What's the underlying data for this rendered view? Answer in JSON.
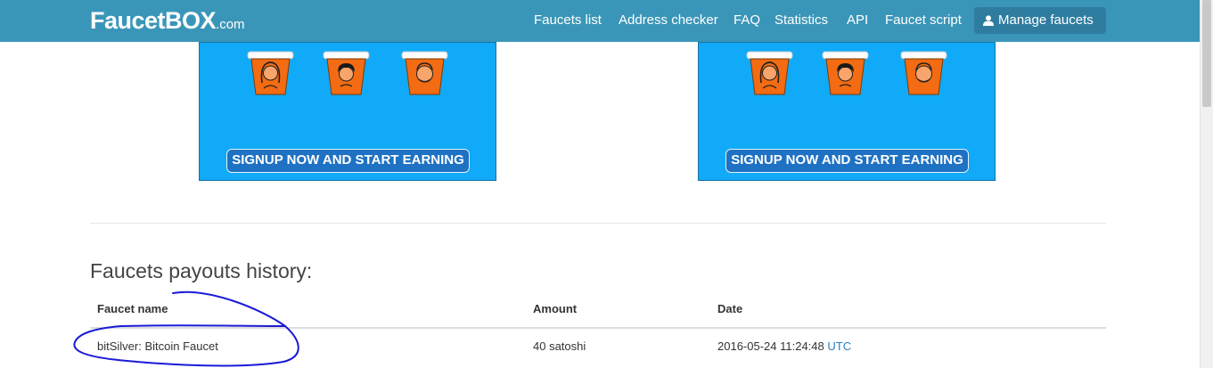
{
  "brand": {
    "name": "FaucetBOX",
    "tld": ".com"
  },
  "nav": {
    "items": [
      {
        "label": "Faucets list"
      },
      {
        "label": "Address checker"
      },
      {
        "label": "FAQ"
      },
      {
        "label": "Statistics"
      },
      {
        "label": "API"
      },
      {
        "label": "Faucet script"
      }
    ],
    "manage": {
      "label": "Manage faucets",
      "icon": "user-icon"
    }
  },
  "banners": [
    {
      "cta": "SIGNUP NOW AND START EARNING"
    },
    {
      "cta": "SIGNUP NOW AND START EARNING"
    }
  ],
  "payouts": {
    "title": "Faucets payouts history:",
    "columns": [
      "Faucet name",
      "Amount",
      "Date"
    ],
    "rows": [
      {
        "faucet": "bitSilver: Bitcoin Faucet",
        "amount": "40 satoshi",
        "date": "2016-05-24 11:24:48",
        "tz": "UTC"
      }
    ]
  },
  "colors": {
    "navbar": "#3a96b8",
    "manage_button": "#2e7da0",
    "banner_bg": "#10aaf8",
    "bucket_orange": "#f36b12",
    "link": "#2a7fc1",
    "annotation_ink": "#1a1ad6"
  }
}
